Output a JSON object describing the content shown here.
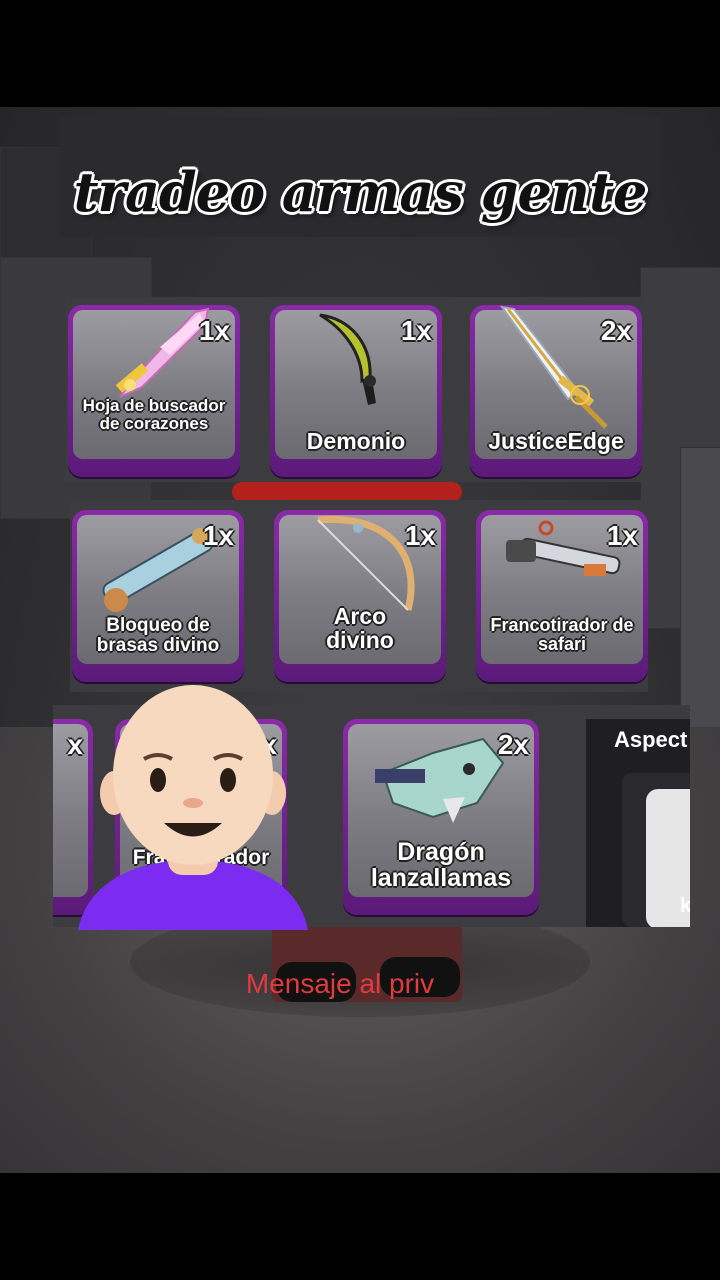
{
  "overlay": {
    "title": "tradeo armas gente",
    "caption": "Mensaje al priv"
  },
  "row1": [
    {
      "qty": "1x",
      "name": "Hoja de buscador de corazones",
      "icon": "pink-crystal-sword-icon"
    },
    {
      "qty": "1x",
      "name": "Demonio",
      "icon": "demon-blade-icon"
    },
    {
      "qty": "2x",
      "name": "JusticeEdge",
      "icon": "justice-sword-icon"
    }
  ],
  "row2": [
    {
      "qty": "1x",
      "name": "Bloqueo de brasas divino",
      "icon": "divine-cannon-icon"
    },
    {
      "qty": "1x",
      "name": "Arco divino",
      "icon": "divine-bow-icon"
    },
    {
      "qty": "1x",
      "name": "Francotirador de safari",
      "icon": "safari-sniper-icon"
    }
  ],
  "row3": [
    {
      "qty": "x",
      "name": "",
      "icon": "partial-card"
    },
    {
      "qty": "1x",
      "name": "Francotirador de safari",
      "icon": "safari-sniper-icon"
    },
    {
      "qty": "2x",
      "name": "Dragón lanzallamas",
      "icon": "dragon-flamethrower-icon"
    }
  ],
  "side_panel": {
    "label": "Aspect",
    "trailing": "k"
  },
  "colors": {
    "card_border": "#8a2aa8",
    "card_bg": "#8c8c92",
    "caption": "#e23a3e",
    "avatar_shirt": "#7b2cf0"
  }
}
